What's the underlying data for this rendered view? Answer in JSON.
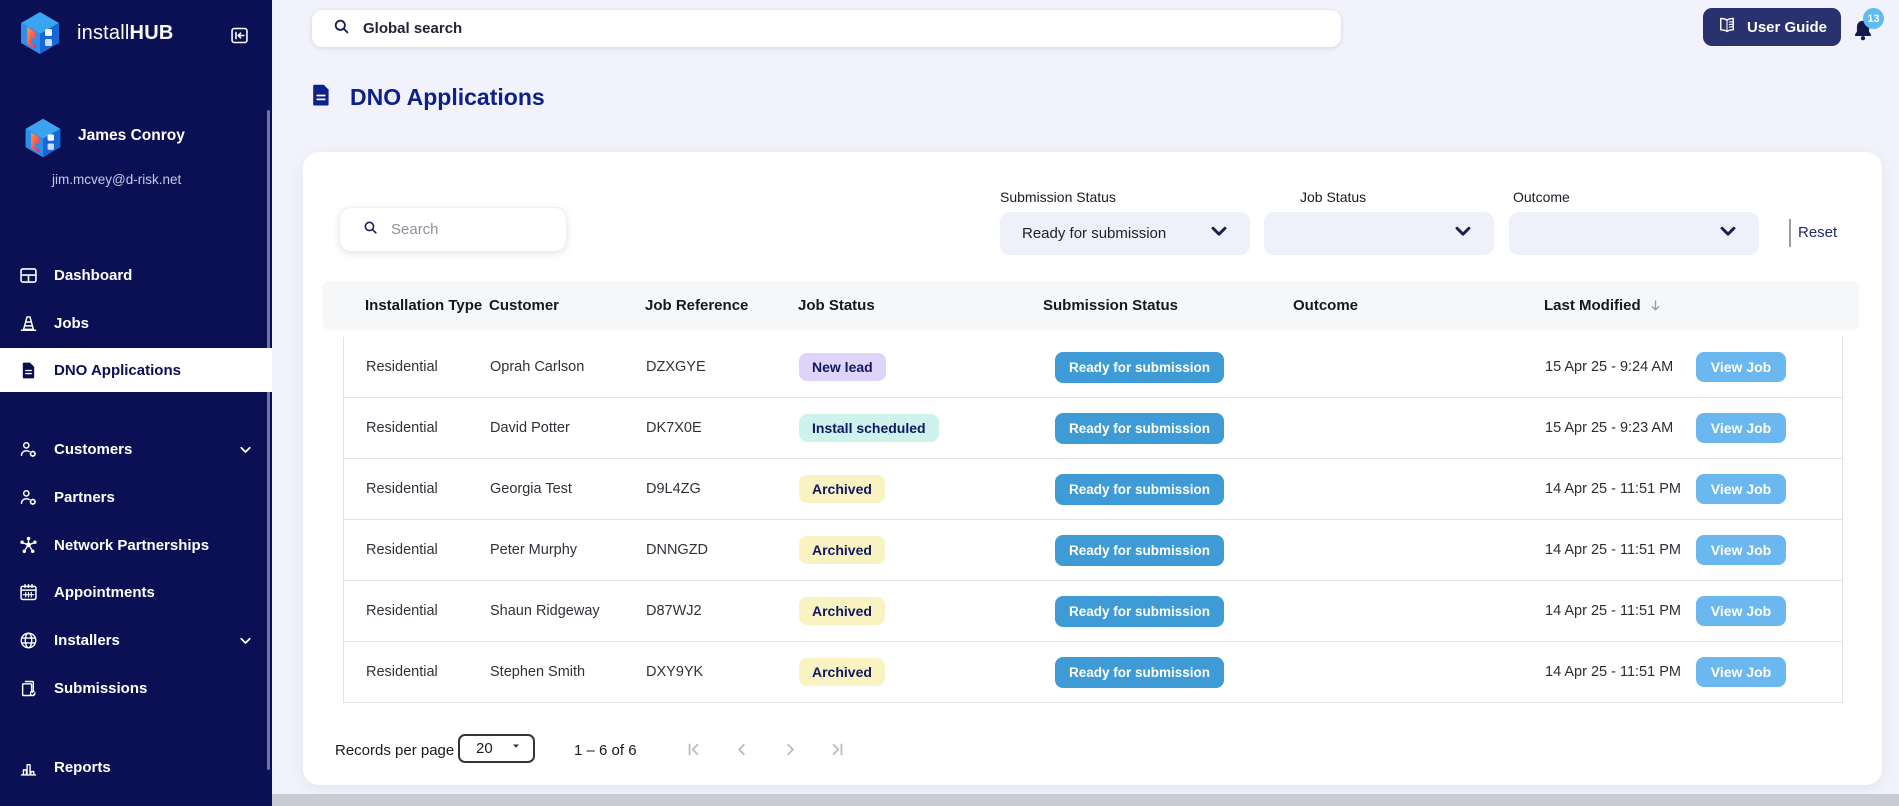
{
  "brand": {
    "name_regular": "install",
    "name_bold": "HUB"
  },
  "topbar": {
    "global_search_placeholder": "Global search",
    "user_guide_label": "User Guide",
    "notification_count": "13"
  },
  "sidebar": {
    "user": {
      "name": "James Conroy",
      "email": "jim.mcvey@d-risk.net"
    },
    "items": [
      {
        "label": "Dashboard",
        "icon": "dashboard-icon",
        "active": false,
        "chevron": false
      },
      {
        "label": "Jobs",
        "icon": "jobs-icon",
        "active": false,
        "chevron": false
      },
      {
        "label": "DNO Applications",
        "icon": "dno-applications-icon",
        "active": true,
        "chevron": false
      },
      {
        "label": "Customers",
        "icon": "customers-icon",
        "active": false,
        "chevron": true
      },
      {
        "label": "Partners",
        "icon": "partners-icon",
        "active": false,
        "chevron": false
      },
      {
        "label": "Network Partnerships",
        "icon": "network-partnerships-icon",
        "active": false,
        "chevron": false
      },
      {
        "label": "Appointments",
        "icon": "appointments-icon",
        "active": false,
        "chevron": false
      },
      {
        "label": "Installers",
        "icon": "installers-icon",
        "active": false,
        "chevron": true
      },
      {
        "label": "Submissions",
        "icon": "submissions-icon",
        "active": false,
        "chevron": false
      },
      {
        "label": "Reports",
        "icon": "reports-icon",
        "active": false,
        "chevron": false
      }
    ]
  },
  "page": {
    "title": "DNO Applications"
  },
  "filters": {
    "search_placeholder": "Search",
    "submission_status": {
      "label": "Submission Status",
      "value": "Ready for submission"
    },
    "job_status": {
      "label": "Job Status",
      "value": ""
    },
    "outcome": {
      "label": "Outcome",
      "value": ""
    },
    "reset_label": "Reset"
  },
  "table": {
    "columns": [
      "Installation Type",
      "Customer",
      "Job Reference",
      "Job Status",
      "Submission Status",
      "Outcome",
      "Last Modified"
    ],
    "sorted_by": "Last Modified",
    "status_colors": {
      "New lead": "#ded4fa",
      "Install scheduled": "#cdf3ec",
      "Archived": "#f8f3c0"
    },
    "rows": [
      {
        "installation_type": "Residential",
        "customer": "Oprah Carlson",
        "job_reference": "DZXGYE",
        "job_status": "New lead",
        "submission_status": "Ready for submission",
        "outcome": "",
        "last_modified": "15 Apr 25 - 9:24 AM",
        "action_label": "View Job"
      },
      {
        "installation_type": "Residential",
        "customer": "David Potter",
        "job_reference": "DK7X0E",
        "job_status": "Install scheduled",
        "submission_status": "Ready for submission",
        "outcome": "",
        "last_modified": "15 Apr 25 - 9:23 AM",
        "action_label": "View Job"
      },
      {
        "installation_type": "Residential",
        "customer": "Georgia Test",
        "job_reference": "D9L4ZG",
        "job_status": "Archived",
        "submission_status": "Ready for submission",
        "outcome": "",
        "last_modified": "14 Apr 25 - 11:51 PM",
        "action_label": "View Job"
      },
      {
        "installation_type": "Residential",
        "customer": "Peter Murphy",
        "job_reference": "DNNGZD",
        "job_status": "Archived",
        "submission_status": "Ready for submission",
        "outcome": "",
        "last_modified": "14 Apr 25 - 11:51 PM",
        "action_label": "View Job"
      },
      {
        "installation_type": "Residential",
        "customer": "Shaun Ridgeway",
        "job_reference": "D87WJ2",
        "job_status": "Archived",
        "submission_status": "Ready for submission",
        "outcome": "",
        "last_modified": "14 Apr 25 - 11:51 PM",
        "action_label": "View Job"
      },
      {
        "installation_type": "Residential",
        "customer": "Stephen Smith",
        "job_reference": "DXY9YK",
        "job_status": "Archived",
        "submission_status": "Ready for submission",
        "outcome": "",
        "last_modified": "14 Apr 25 - 11:51 PM",
        "action_label": "View Job"
      }
    ]
  },
  "pagination": {
    "records_per_page_label": "Records per page",
    "records_per_page_value": "20",
    "range_label": "1 – 6 of 6"
  },
  "colors": {
    "sidebar_bg": "#0b1055",
    "title_navy": "#0e2089",
    "ready_pill": "#3e9bd5",
    "view_job_button": "#6bb7f0",
    "badge_new_lead": "#ded4fa",
    "badge_install_scheduled": "#cdf3ec",
    "badge_archived": "#f8f3c0",
    "notification_badge": "#5fbcf2",
    "filter_field_bg": "#eef0fa"
  }
}
